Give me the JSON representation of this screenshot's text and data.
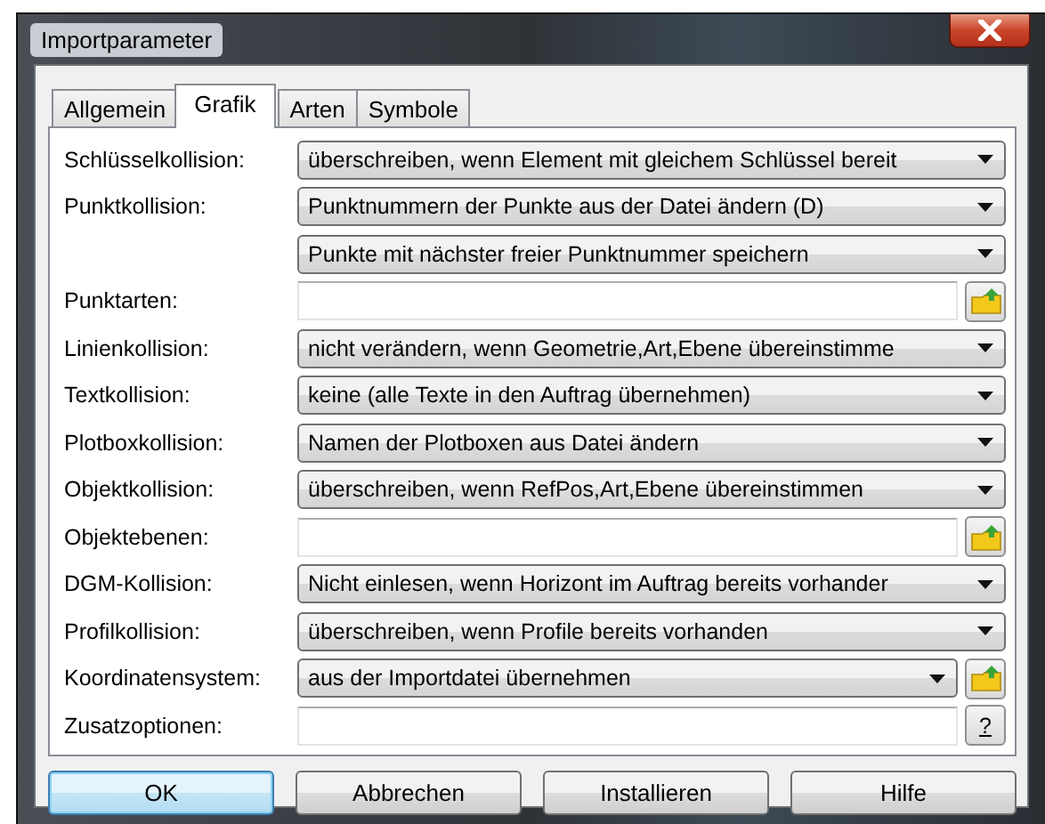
{
  "window": {
    "title": "Importparameter"
  },
  "tabs": [
    {
      "label": "Allgemein",
      "selected": false
    },
    {
      "label": "Grafik",
      "selected": true
    },
    {
      "label": "Arten",
      "selected": false
    },
    {
      "label": "Symbole",
      "selected": false
    }
  ],
  "rows": [
    {
      "label": "Schlüsselkollision:",
      "kind": "select",
      "value": "überschreiben, wenn Element mit gleichem Schlüssel bereit"
    },
    {
      "label": "Punktkollision:",
      "kind": "select",
      "value": "Punktnummern der Punkte aus der Datei ändern (D)"
    },
    {
      "kind": "select",
      "value": "Punkte mit nächster freier Punktnummer speichern"
    },
    {
      "label": "Punktarten:",
      "kind": "text",
      "action": {
        "kind": "folder"
      }
    },
    {
      "label": "Linienkollision:",
      "kind": "select",
      "value": "nicht verändern, wenn Geometrie,Art,Ebene übereinstimme"
    },
    {
      "label": "Textkollision:",
      "kind": "select",
      "value": "keine (alle Texte in den Auftrag übernehmen)"
    },
    {
      "label": "Plotboxkollision:",
      "kind": "select",
      "value": "Namen der Plotboxen aus Datei ändern"
    },
    {
      "label": "Objektkollision:",
      "kind": "select",
      "value": "überschreiben, wenn RefPos,Art,Ebene übereinstimmen"
    },
    {
      "label": "Objektebenen:",
      "kind": "text",
      "action": {
        "kind": "folder"
      }
    },
    {
      "label": "DGM-Kollision:",
      "kind": "select",
      "value": "Nicht einlesen, wenn Horizont im Auftrag bereits vorhander"
    },
    {
      "label": "Profilkollision:",
      "kind": "select",
      "value": "überschreiben, wenn Profile bereits vorhanden"
    },
    {
      "label": "Koordinatensystem:",
      "kind": "select",
      "value": "aus der Importdatei übernehmen",
      "action": {
        "kind": "folder"
      }
    },
    {
      "label": "Zusatzoptionen:",
      "kind": "text",
      "action": {
        "kind": "help",
        "label": "?"
      }
    }
  ],
  "buttons": [
    {
      "label": "OK",
      "default": true
    },
    {
      "label": "Abbrechen",
      "default": false
    },
    {
      "label": "Installieren",
      "default": false
    },
    {
      "label": "Hilfe",
      "default": false
    }
  ]
}
